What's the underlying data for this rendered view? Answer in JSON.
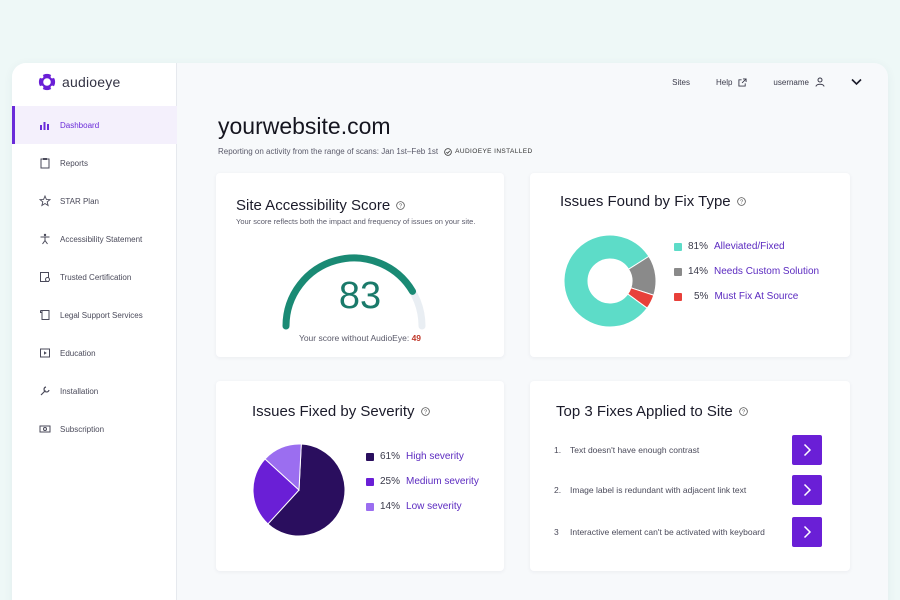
{
  "app": {
    "logo_text": "audioeye"
  },
  "sidebar": {
    "items": [
      {
        "label": "Dashboard",
        "icon": "bar-chart-icon",
        "active": true
      },
      {
        "label": "Reports",
        "icon": "clipboard-icon"
      },
      {
        "label": "STAR Plan",
        "icon": "star-icon"
      },
      {
        "label": "Accessibility Statement",
        "icon": "accessibility-icon"
      },
      {
        "label": "Trusted Certification",
        "icon": "certificate-icon"
      },
      {
        "label": "Legal Support Services",
        "icon": "scroll-icon"
      },
      {
        "label": "Education",
        "icon": "video-icon"
      },
      {
        "label": "Installation",
        "icon": "wrench-icon"
      },
      {
        "label": "Subscription",
        "icon": "money-icon"
      }
    ]
  },
  "topbar": {
    "sites": "Sites",
    "help": "Help",
    "username": "username"
  },
  "header": {
    "title": "yourwebsite.com",
    "subtitle": "Reporting on activity from the range of scans: Jan 1st–Feb 1st",
    "badge": "AUDIOEYE INSTALLED"
  },
  "score_card": {
    "title": "Site Accessibility Score",
    "description": "Your score reflects both the impact and frequency of issues on your site.",
    "score": "83",
    "score_value": 83,
    "without_label": "Your score without AudioEye:",
    "without_value": "49"
  },
  "fix_type_card": {
    "title": "Issues Found by Fix Type",
    "items": [
      {
        "pct": "81%",
        "label": "Alleviated/Fixed",
        "value": 81,
        "color": "#5ddcc8"
      },
      {
        "pct": "14%",
        "label": "Needs Custom Solution",
        "value": 14,
        "color": "#8a8a8a"
      },
      {
        "pct": "5%",
        "label": "Must Fix At Source",
        "value": 5,
        "color": "#e8403a"
      }
    ]
  },
  "severity_card": {
    "title": "Issues Fixed by Severity",
    "items": [
      {
        "pct": "61%",
        "label": "High severity",
        "value": 61,
        "color": "#2a0e5e"
      },
      {
        "pct": "25%",
        "label": "Medium severity",
        "value": 25,
        "color": "#6a1fd6"
      },
      {
        "pct": "14%",
        "label": "Low severity",
        "value": 14,
        "color": "#9b6ef0"
      }
    ]
  },
  "fixes_card": {
    "title": "Top 3 Fixes Applied to Site",
    "items": [
      {
        "num": "1.",
        "text": "Text doesn't have enough contrast"
      },
      {
        "num": "2.",
        "text": "Image label is redundant with adjacent link text"
      },
      {
        "num": "3",
        "text": "Interactive element can't be activated with keyboard"
      }
    ]
  },
  "colors": {
    "accent": "#6a1fd6",
    "gauge": "#1a8a74",
    "gauge_track": "#e9eef3",
    "without_value": "#c0392b"
  }
}
